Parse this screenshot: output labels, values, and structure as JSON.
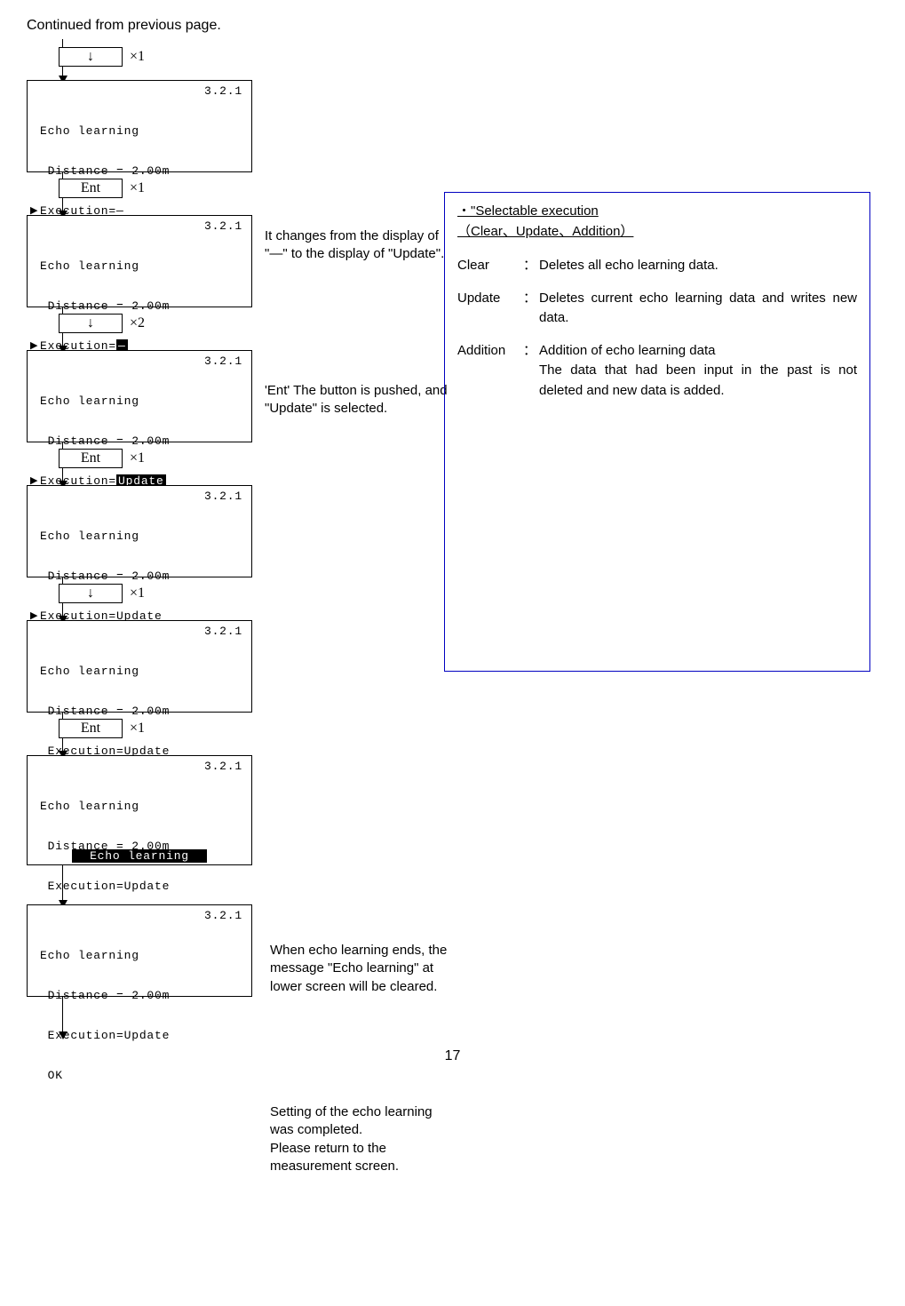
{
  "header": {
    "continued": "Continued from previous page."
  },
  "buttons": {
    "down": "↓",
    "ent": "Ent"
  },
  "times": {
    "x1": "×1",
    "x2": "×2"
  },
  "lcd": {
    "title": "Echo learning",
    "version": "3.2.1",
    "distance": " Distance = 2.00m",
    "exec_dash": "Execution=―",
    "exec_update": "Execution=Update",
    "exec_dash_inv_val": "―",
    "exec_update_inv_val": "Update",
    "exec_prefix": "Execution=",
    "ok": " OK",
    "footer_echo": "Echo learning"
  },
  "annotations": {
    "a1": "It changes from the display of \"―\" to the display of \"Update\".",
    "a2": "'Ent' The button is pushed, and \"Update\" is selected.",
    "a3": "When echo learning ends, the message \"Echo learning\" at lower screen will be cleared.",
    "a4": "Setting of the echo learning was completed.\nPlease return to the measurement screen."
  },
  "sidebox": {
    "title_line1": "・\"Selectable execution",
    "title_line2": "（Clear、Update、Addition）",
    "defs": [
      {
        "term": "Clear",
        "sep": "：",
        "desc": "Deletes all echo learning data."
      },
      {
        "term": "Update",
        "sep": "：",
        "desc": "Deletes current echo learning data and writes new data."
      },
      {
        "term": "Addition",
        "sep": "：",
        "desc": "Addition of echo learning data\nThe data that had been input in the past is not deleted and new data is added."
      }
    ]
  },
  "page_number": "17"
}
